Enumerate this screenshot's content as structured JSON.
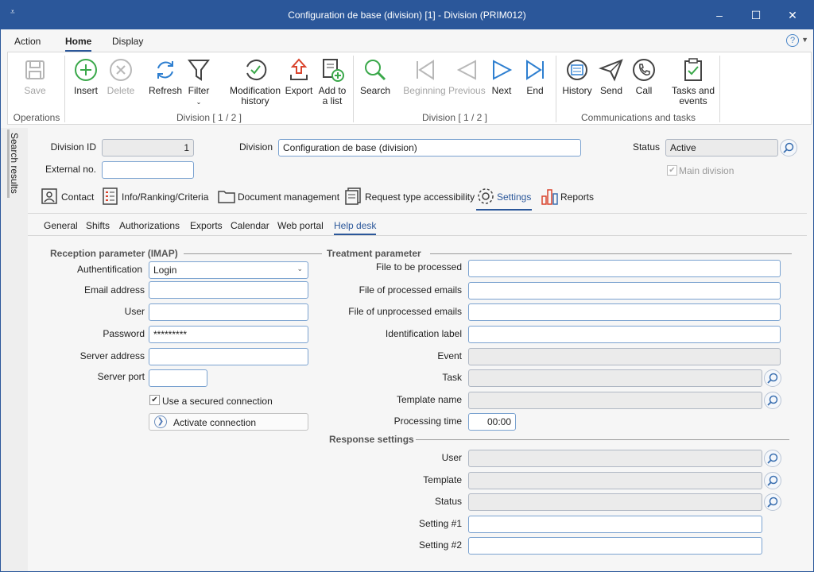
{
  "window": {
    "title": "Configuration de base (division) [1] - Division (PRIM012)",
    "quick_access": "⩡"
  },
  "menu": {
    "tabs": [
      "Action",
      "Home",
      "Display"
    ],
    "active": "Home",
    "help_label": "?"
  },
  "ribbon": {
    "buttons": {
      "save": "Save",
      "insert": "Insert",
      "delete": "Delete",
      "refresh": "Refresh",
      "filter": "Filter",
      "modification_history_1": "Modification",
      "modification_history_2": "history",
      "export": "Export",
      "add_to_list_1": "Add to",
      "add_to_list_2": "a list",
      "search": "Search",
      "beginning": "Beginning",
      "previous": "Previous",
      "next": "Next",
      "end": "End",
      "history": "History",
      "send": "Send",
      "call": "Call",
      "tasks_events_1": "Tasks and",
      "tasks_events_2": "events"
    },
    "groups": {
      "operations": "Operations",
      "division1": "Division [ 1 / 2 ]",
      "division2": "Division [ 1 / 2 ]",
      "communications": "Communications and tasks"
    }
  },
  "side": {
    "search_results": "Search results"
  },
  "header": {
    "division_id_label": "Division ID",
    "division_id": "1",
    "external_no_label": "External no.",
    "external_no": "",
    "division_label": "Division",
    "division": "Configuration de base (division)",
    "status_label": "Status",
    "status": "Active",
    "main_division_label": "Main division",
    "main_division_checked": "✔"
  },
  "tabs": {
    "contact": "Contact",
    "info": "Info/Ranking/Criteria",
    "documents": "Document management",
    "request_type": "Request type accessibility",
    "settings": "Settings",
    "reports": "Reports"
  },
  "subtabs": {
    "general": "General",
    "shifts": "Shifts",
    "authorizations": "Authorizations",
    "exports": "Exports",
    "calendar": "Calendar",
    "web_portal": "Web portal",
    "help_desk": "Help desk"
  },
  "imap": {
    "section": "Reception parameter (IMAP)",
    "authentification_label": "Authentification",
    "authentification": "Login",
    "email_label": "Email address",
    "email": "",
    "user_label": "User",
    "user": "",
    "password_label": "Password",
    "password": "*********",
    "server_address_label": "Server address",
    "server_address": "",
    "server_port_label": "Server port",
    "server_port": "",
    "secured_label": "Use a secured connection",
    "secured_checked": "✔",
    "activate_label": "Activate connection"
  },
  "treatment": {
    "section": "Treatment parameter",
    "file_to_process_label": "File to be processed",
    "file_processed_label": "File of processed emails",
    "file_unprocessed_label": "File of unprocessed emails",
    "identification_label": "Identification label",
    "event_label": "Event",
    "task_label": "Task",
    "template_name_label": "Template name",
    "processing_time_label": "Processing time",
    "processing_time": "00:00"
  },
  "response": {
    "section": "Response settings",
    "user_label": "User",
    "template_label": "Template",
    "status_label": "Status",
    "setting1_label": "Setting #1",
    "setting2_label": "Setting #2"
  }
}
